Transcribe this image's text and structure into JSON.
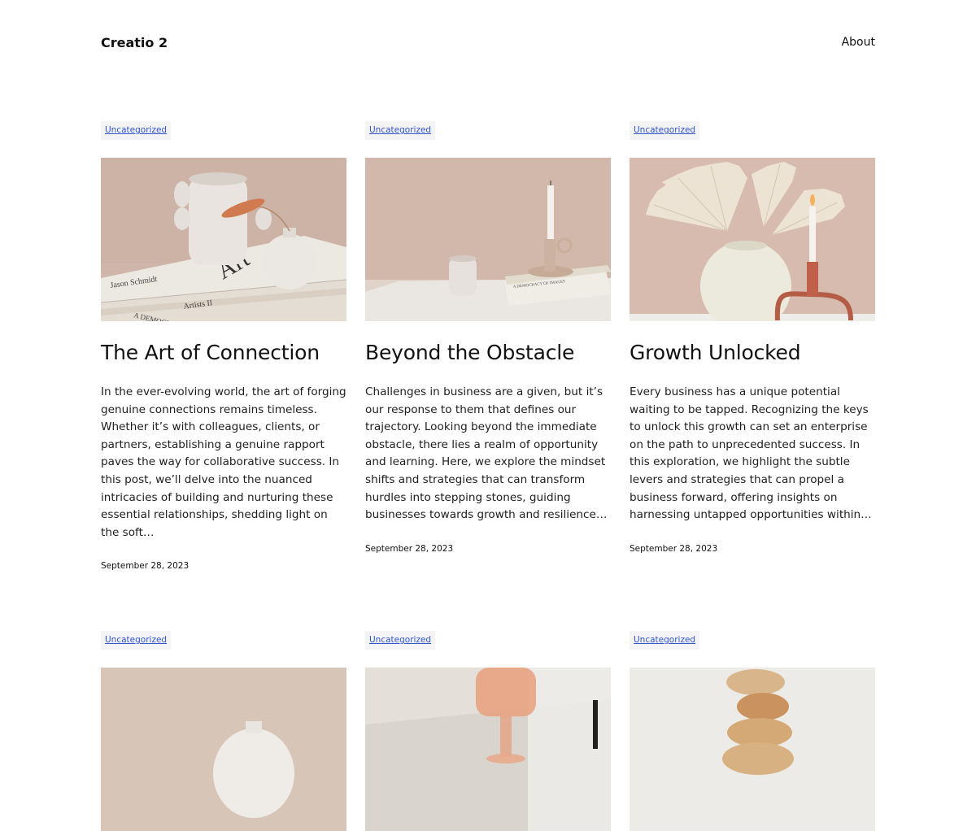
{
  "header": {
    "site_title": "Creatio 2",
    "nav": [
      {
        "label": "About"
      }
    ]
  },
  "posts": [
    {
      "category": "Uncategorized",
      "title": "The Art of Connection",
      "excerpt": "In the ever-evolving world, the art of forging genuine connections remains timeless. Whether it’s with colleagues, clients, or partners, establishing a genuine rapport paves the way for collaborative success. In this post, we’ll delve into the nuanced intricacies of building and nurturing these essential relationships, shedding light on the soft…",
      "date": "September 28, 2023",
      "image_text": [
        "Art",
        "Jason Schmidt",
        "Artists II",
        "A DEMOCRACY"
      ]
    },
    {
      "category": "Uncategorized",
      "title": "Beyond the Obstacle",
      "excerpt": "Challenges in business are a given, but it’s our response to them that defines our trajectory. Looking beyond the immediate obstacle, there lies a realm of opportunity and learning. Here, we explore the mindset shifts and strategies that can transform hurdles into stepping stones, guiding businesses towards growth and resilience…",
      "date": "September 28, 2023",
      "image_text": [
        "A DEMOCRACY OF IMAGES"
      ]
    },
    {
      "category": "Uncategorized",
      "title": "Growth Unlocked",
      "excerpt": "Every business has a unique potential waiting to be tapped. Recognizing the keys to unlock this growth can set an enterprise on the path to unprecedented success. In this exploration, we highlight the subtle levers and strategies that can propel a business forward, offering insights on harnessing untapped opportunities within…",
      "date": "September 28, 2023"
    },
    {
      "category": "Uncategorized"
    },
    {
      "category": "Uncategorized"
    },
    {
      "category": "Uncategorized"
    }
  ],
  "colors": {
    "link": "#2f54c9",
    "category_bg": "#f4f4f6",
    "text": "#111111"
  }
}
